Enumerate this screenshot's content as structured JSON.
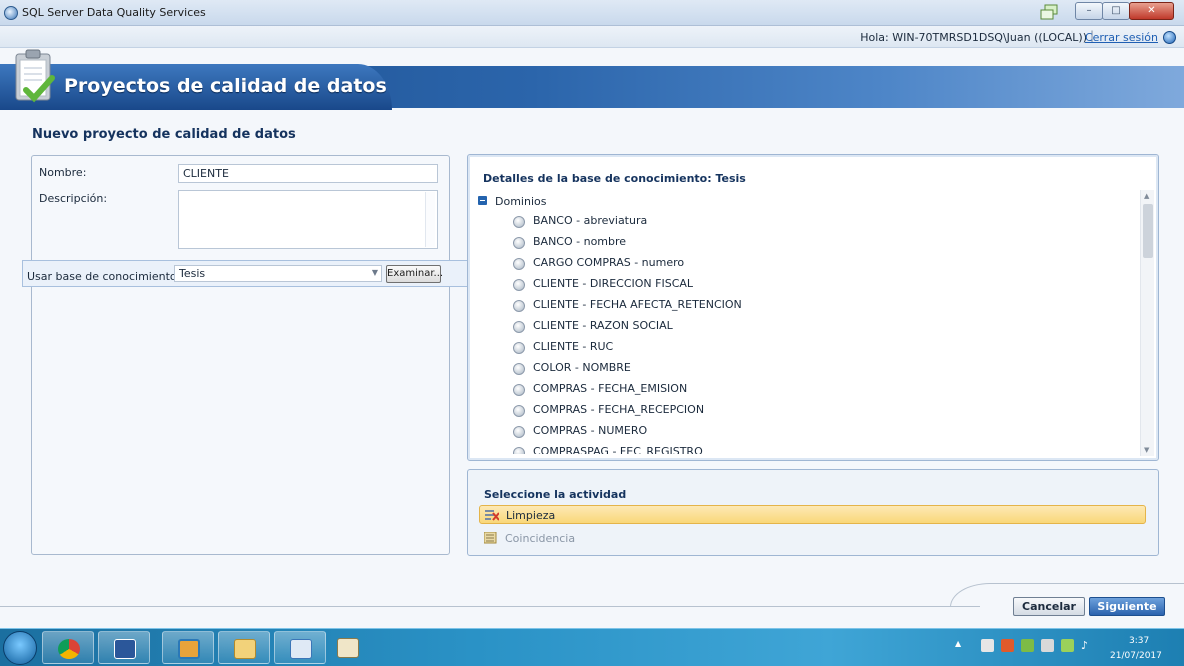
{
  "window": {
    "title": "SQL Server Data Quality Services"
  },
  "header": {
    "greeting": "Hola: WIN-70TMRSD1DSQ\\Juan ((LOCAL))",
    "separator": "|",
    "signout": "Cerrar sesión"
  },
  "banner": {
    "title": "Proyectos de calidad de datos"
  },
  "page": {
    "title": "Nuevo proyecto de calidad de datos"
  },
  "form": {
    "name_label": "Nombre:",
    "name_value": "CLIENTE",
    "description_label": "Descripción:",
    "description_value": "",
    "kb_label": "Usar base de conocimiento:",
    "kb_value": "Tesis",
    "browse_label": "Examinar..."
  },
  "kb_details": {
    "title": "Detalles de la base de conocimiento: Tesis",
    "root_label": "Dominios",
    "domains": [
      "BANCO - abreviatura",
      "BANCO - nombre",
      "CARGO COMPRAS - numero",
      "CLIENTE - DIRECCION FISCAL",
      "CLIENTE - FECHA AFECTA_RETENCION",
      "CLIENTE - RAZON SOCIAL",
      "CLIENTE - RUC",
      "COLOR - NOMBRE",
      "COMPRAS - FECHA_EMISION",
      "COMPRAS - FECHA_RECEPCION",
      "COMPRAS - NUMERO",
      "COMPRASPAG - FEC_REGISTRO"
    ]
  },
  "activity": {
    "title": "Seleccione la actividad",
    "options": [
      {
        "label": "Limpieza",
        "selected": true,
        "enabled": true,
        "icon": "cleansing-icon"
      },
      {
        "label": "Coincidencia",
        "selected": false,
        "enabled": false,
        "icon": "matching-icon"
      }
    ]
  },
  "buttons": {
    "cancel": "Cancelar",
    "next": "Siguiente"
  },
  "taskbar": {
    "apps": [
      "chrome-icon",
      "word-icon",
      "app-icon",
      "file-explorer-icon",
      "dqs-client-icon",
      "tools-icon"
    ],
    "clock_time": "3:37",
    "clock_date": "21/07/2017"
  },
  "colors": {
    "accent": "#2b65ab",
    "selection": "#f9d779",
    "link": "#1f5fb3",
    "disabled_text": "#8a96a6"
  }
}
